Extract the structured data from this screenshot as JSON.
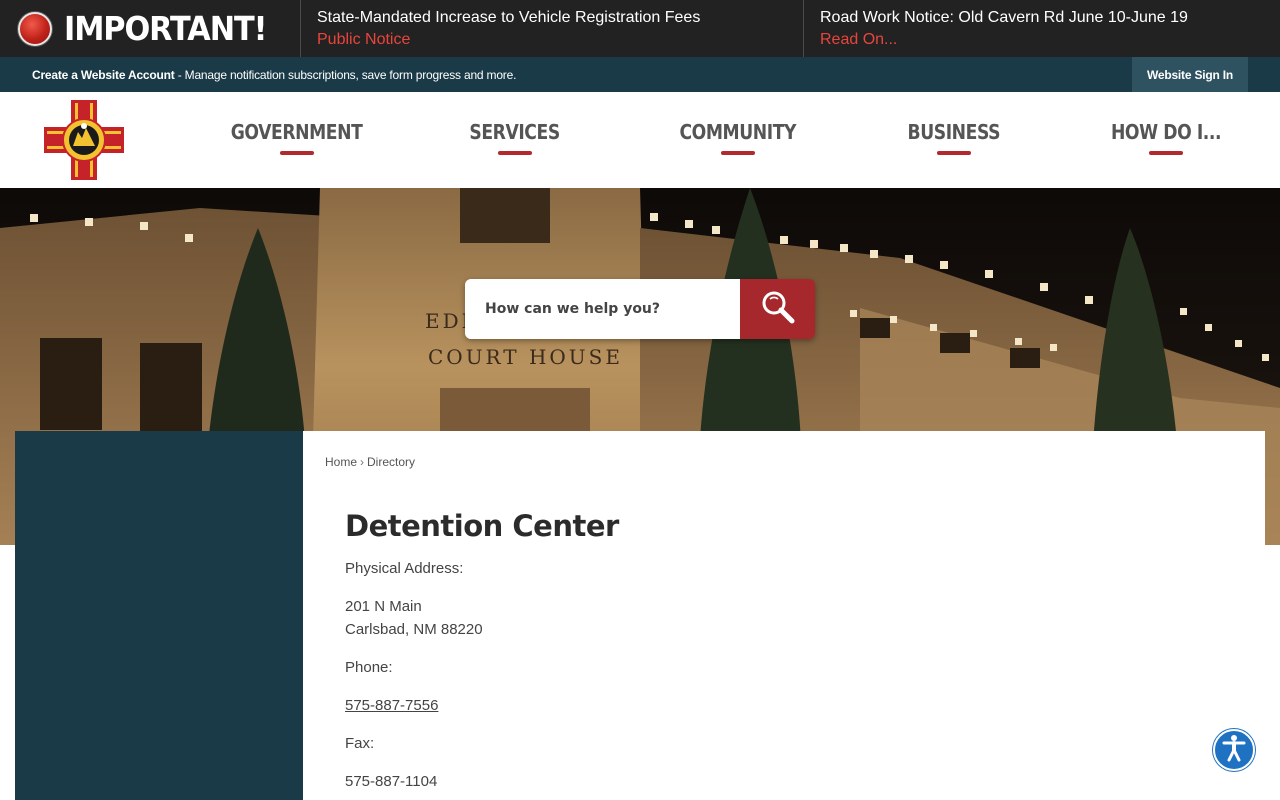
{
  "alerts": {
    "label": "IMPORTANT!",
    "items": [
      {
        "title": "State-Mandated Increase to Vehicle Registration Fees",
        "subtitle": "Public Notice"
      },
      {
        "title": "Road Work Notice: Old Cavern Rd June 10-June 19",
        "subtitle": "Read On..."
      }
    ]
  },
  "account_bar": {
    "create_link": "Create a Website Account",
    "description": " - Manage notification subscriptions, save form progress and more.",
    "signin_label": "Website Sign In"
  },
  "logo": {
    "icon": "county-seal-logo"
  },
  "nav": {
    "items": [
      {
        "label": "GOVERNMENT"
      },
      {
        "label": "SERVICES"
      },
      {
        "label": "COMMUNITY"
      },
      {
        "label": "BUSINESS"
      },
      {
        "label": "HOW DO I..."
      }
    ]
  },
  "hero": {
    "sign_line1": "EDDY COUNTY",
    "sign_line2": "COURT HOUSE"
  },
  "search": {
    "placeholder": "How can we help you?",
    "icon": "search-icon"
  },
  "breadcrumb": {
    "home": "Home",
    "separator": "›",
    "current": "Directory"
  },
  "page": {
    "title": "Detention Center",
    "address_label": "Physical Address:",
    "address_line1": "201 N Main",
    "address_line2": "Carlsbad, NM 88220",
    "phone_label": "Phone:",
    "phone": "575-887-7556",
    "fax_label": "Fax:",
    "fax": "575-887-1104"
  },
  "accessibility": {
    "icon": "accessibility-icon"
  },
  "colors": {
    "alert_bg": "#222222",
    "alert_accent": "#e8453c",
    "account_bg": "#1b3a47",
    "nav_text": "#555555",
    "nav_underline": "#b22a2e",
    "search_button": "#a6282c",
    "sidebar_bg": "#1b3a47",
    "a11y_blue": "#1f72c1"
  }
}
